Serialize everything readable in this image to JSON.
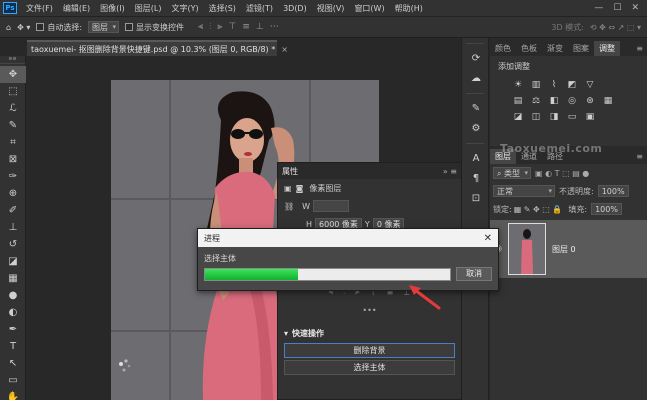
{
  "menubar": {
    "logo": "Ps",
    "items": [
      "文件(F)",
      "编辑(E)",
      "图像(I)",
      "图层(L)",
      "文字(Y)",
      "选择(S)",
      "滤镜(T)",
      "3D(D)",
      "视图(V)",
      "窗口(W)",
      "帮助(H)"
    ],
    "window_controls": [
      "—",
      "☐",
      "✕"
    ]
  },
  "optbar": {
    "auto_select_label": "自动选择:",
    "auto_select_value": "图层",
    "show_transform_label": "显示变换控件",
    "mode_3d_label": "3D 模式:"
  },
  "document": {
    "tab_title": "taoxuemei- 抠图删除背景快捷键.psd @ 10.3% (图层 0, RGB/8) *",
    "close": "×"
  },
  "panels": {
    "top_tabs": [
      "颜色",
      "色板",
      "渐变",
      "图案",
      "调整"
    ],
    "top_active": "调整",
    "adjust_title": "添加调整",
    "layer_tabs": [
      "图层",
      "通道",
      "路径"
    ],
    "layer_active": "图层",
    "watermark": "Taoxuemei.com",
    "filter_label": "类型",
    "blend_mode": "正常",
    "opacity_label": "不透明度:",
    "opacity_value": "100%",
    "lock_label": "锁定:",
    "fill_label": "填充:",
    "fill_value": "100%",
    "layer_name": "图层 0"
  },
  "properties": {
    "title": "属性",
    "kind": "像素图层",
    "w_label": "W",
    "h_label": "H",
    "h_value": "6000 像素",
    "y_label": "Y",
    "y_value": "0 像素",
    "quick_actions_title": "快速操作",
    "remove_bg": "删除背景",
    "select_subject": "选择主体",
    "more": "•••"
  },
  "progress": {
    "title": "进程",
    "message": "选择主体",
    "percent": 38,
    "cancel": "取消",
    "close": "✕"
  },
  "colors": {
    "accent_green": "#22c640",
    "arrow_red": "#e23b3b",
    "dress_pink": "#d96b7c"
  }
}
